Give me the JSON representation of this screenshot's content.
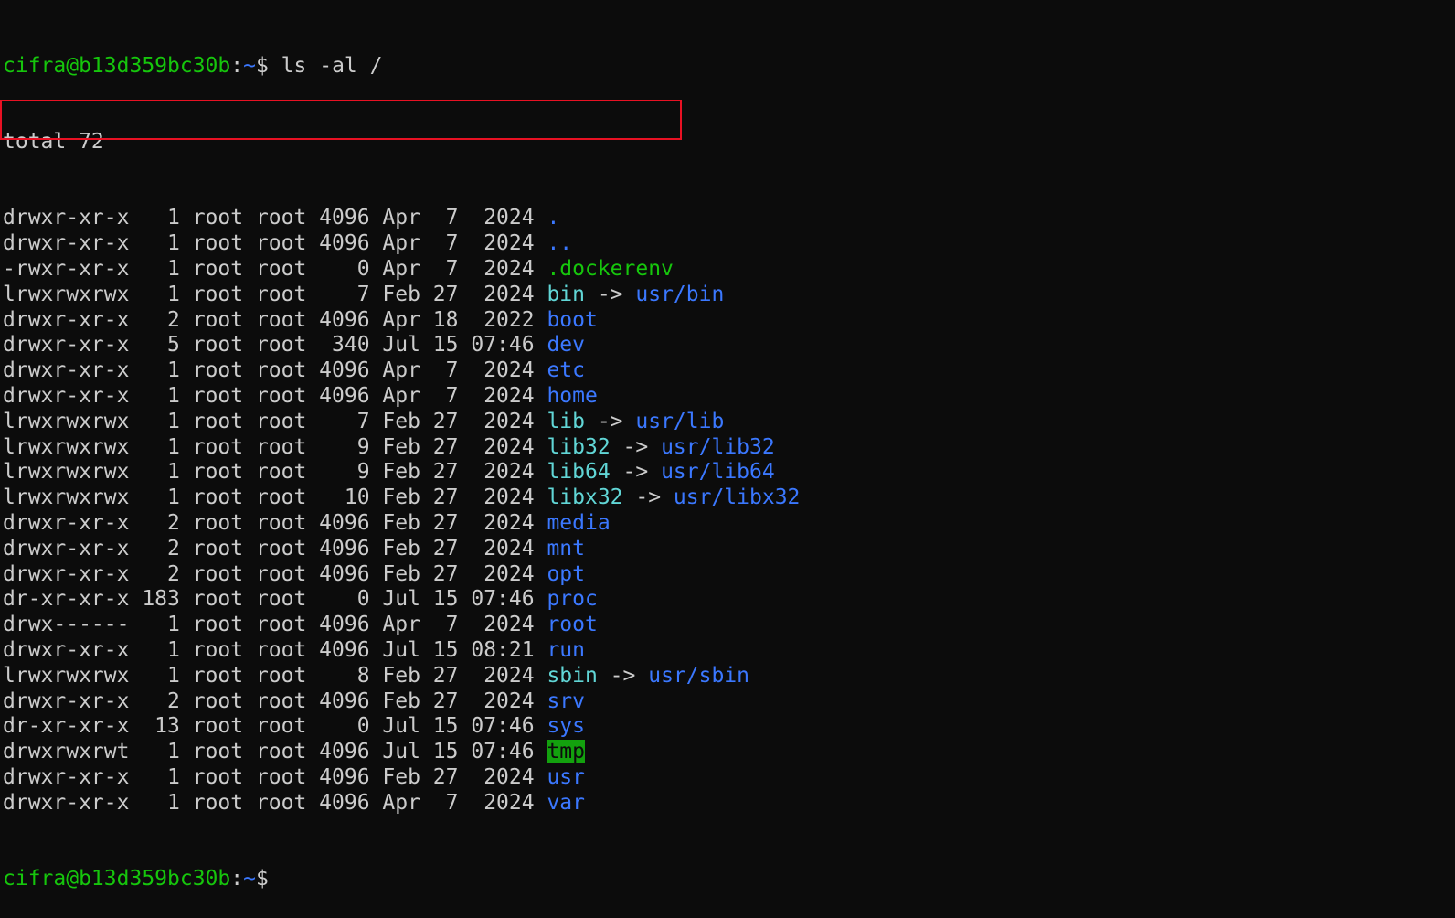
{
  "terminal": {
    "prompt_user": "cifra@b13d359bc30b",
    "prompt_sep": ":",
    "prompt_path": "~",
    "prompt_symbol": "$",
    "command": " ls -al /",
    "total": "total 72",
    "rows": [
      {
        "perm": "drwxr-xr-x",
        "links": "  1",
        "owner": "root",
        "group": "root",
        "size": "4096",
        "date": "Apr  7  2024",
        "name": ".",
        "kind": "dir",
        "target": ""
      },
      {
        "perm": "drwxr-xr-x",
        "links": "  1",
        "owner": "root",
        "group": "root",
        "size": "4096",
        "date": "Apr  7  2024",
        "name": "..",
        "kind": "dir",
        "target": ""
      },
      {
        "perm": "-rwxr-xr-x",
        "links": "  1",
        "owner": "root",
        "group": "root",
        "size": "   0",
        "date": "Apr  7  2024",
        "name": ".dockerenv",
        "kind": "exec",
        "target": ""
      },
      {
        "perm": "lrwxrwxrwx",
        "links": "  1",
        "owner": "root",
        "group": "root",
        "size": "   7",
        "date": "Feb 27  2024",
        "name": "bin",
        "kind": "link",
        "target": "usr/bin"
      },
      {
        "perm": "drwxr-xr-x",
        "links": "  2",
        "owner": "root",
        "group": "root",
        "size": "4096",
        "date": "Apr 18  2022",
        "name": "boot",
        "kind": "dir",
        "target": ""
      },
      {
        "perm": "drwxr-xr-x",
        "links": "  5",
        "owner": "root",
        "group": "root",
        "size": " 340",
        "date": "Jul 15 07:46",
        "name": "dev",
        "kind": "dir",
        "target": ""
      },
      {
        "perm": "drwxr-xr-x",
        "links": "  1",
        "owner": "root",
        "group": "root",
        "size": "4096",
        "date": "Apr  7  2024",
        "name": "etc",
        "kind": "dir",
        "target": ""
      },
      {
        "perm": "drwxr-xr-x",
        "links": "  1",
        "owner": "root",
        "group": "root",
        "size": "4096",
        "date": "Apr  7  2024",
        "name": "home",
        "kind": "dir",
        "target": ""
      },
      {
        "perm": "lrwxrwxrwx",
        "links": "  1",
        "owner": "root",
        "group": "root",
        "size": "   7",
        "date": "Feb 27  2024",
        "name": "lib",
        "kind": "link",
        "target": "usr/lib"
      },
      {
        "perm": "lrwxrwxrwx",
        "links": "  1",
        "owner": "root",
        "group": "root",
        "size": "   9",
        "date": "Feb 27  2024",
        "name": "lib32",
        "kind": "link",
        "target": "usr/lib32"
      },
      {
        "perm": "lrwxrwxrwx",
        "links": "  1",
        "owner": "root",
        "group": "root",
        "size": "   9",
        "date": "Feb 27  2024",
        "name": "lib64",
        "kind": "link",
        "target": "usr/lib64"
      },
      {
        "perm": "lrwxrwxrwx",
        "links": "  1",
        "owner": "root",
        "group": "root",
        "size": "  10",
        "date": "Feb 27  2024",
        "name": "libx32",
        "kind": "link",
        "target": "usr/libx32"
      },
      {
        "perm": "drwxr-xr-x",
        "links": "  2",
        "owner": "root",
        "group": "root",
        "size": "4096",
        "date": "Feb 27  2024",
        "name": "media",
        "kind": "dir",
        "target": ""
      },
      {
        "perm": "drwxr-xr-x",
        "links": "  2",
        "owner": "root",
        "group": "root",
        "size": "4096",
        "date": "Feb 27  2024",
        "name": "mnt",
        "kind": "dir",
        "target": ""
      },
      {
        "perm": "drwxr-xr-x",
        "links": "  2",
        "owner": "root",
        "group": "root",
        "size": "4096",
        "date": "Feb 27  2024",
        "name": "opt",
        "kind": "dir",
        "target": ""
      },
      {
        "perm": "dr-xr-xr-x",
        "links": "183",
        "owner": "root",
        "group": "root",
        "size": "   0",
        "date": "Jul 15 07:46",
        "name": "proc",
        "kind": "dir",
        "target": ""
      },
      {
        "perm": "drwx------",
        "links": "  1",
        "owner": "root",
        "group": "root",
        "size": "4096",
        "date": "Apr  7  2024",
        "name": "root",
        "kind": "dir",
        "target": ""
      },
      {
        "perm": "drwxr-xr-x",
        "links": "  1",
        "owner": "root",
        "group": "root",
        "size": "4096",
        "date": "Jul 15 08:21",
        "name": "run",
        "kind": "dir",
        "target": ""
      },
      {
        "perm": "lrwxrwxrwx",
        "links": "  1",
        "owner": "root",
        "group": "root",
        "size": "   8",
        "date": "Feb 27  2024",
        "name": "sbin",
        "kind": "link",
        "target": "usr/sbin"
      },
      {
        "perm": "drwxr-xr-x",
        "links": "  2",
        "owner": "root",
        "group": "root",
        "size": "4096",
        "date": "Feb 27  2024",
        "name": "srv",
        "kind": "dir",
        "target": ""
      },
      {
        "perm": "dr-xr-xr-x",
        "links": " 13",
        "owner": "root",
        "group": "root",
        "size": "   0",
        "date": "Jul 15 07:46",
        "name": "sys",
        "kind": "dir",
        "target": ""
      },
      {
        "perm": "drwxrwxrwt",
        "links": "  1",
        "owner": "root",
        "group": "root",
        "size": "4096",
        "date": "Jul 15 07:46",
        "name": "tmp",
        "kind": "sticky",
        "target": ""
      },
      {
        "perm": "drwxr-xr-x",
        "links": "  1",
        "owner": "root",
        "group": "root",
        "size": "4096",
        "date": "Feb 27  2024",
        "name": "usr",
        "kind": "dir",
        "target": ""
      },
      {
        "perm": "drwxr-xr-x",
        "links": "  1",
        "owner": "root",
        "group": "root",
        "size": "4096",
        "date": "Apr  7  2024",
        "name": "var",
        "kind": "dir",
        "target": ""
      }
    ],
    "link_arrow": " -> ",
    "highlighted_name": ".dockerenv"
  },
  "colors": {
    "background": "#0c0c0c",
    "foreground": "#cccccc",
    "prompt_user": "#16c60c",
    "prompt_path": "#3b78ff",
    "directory": "#3b78ff",
    "symlink": "#61d6d6",
    "executable": "#16c60c",
    "sticky_bg": "#13a10e",
    "highlight_border": "#e81123"
  }
}
